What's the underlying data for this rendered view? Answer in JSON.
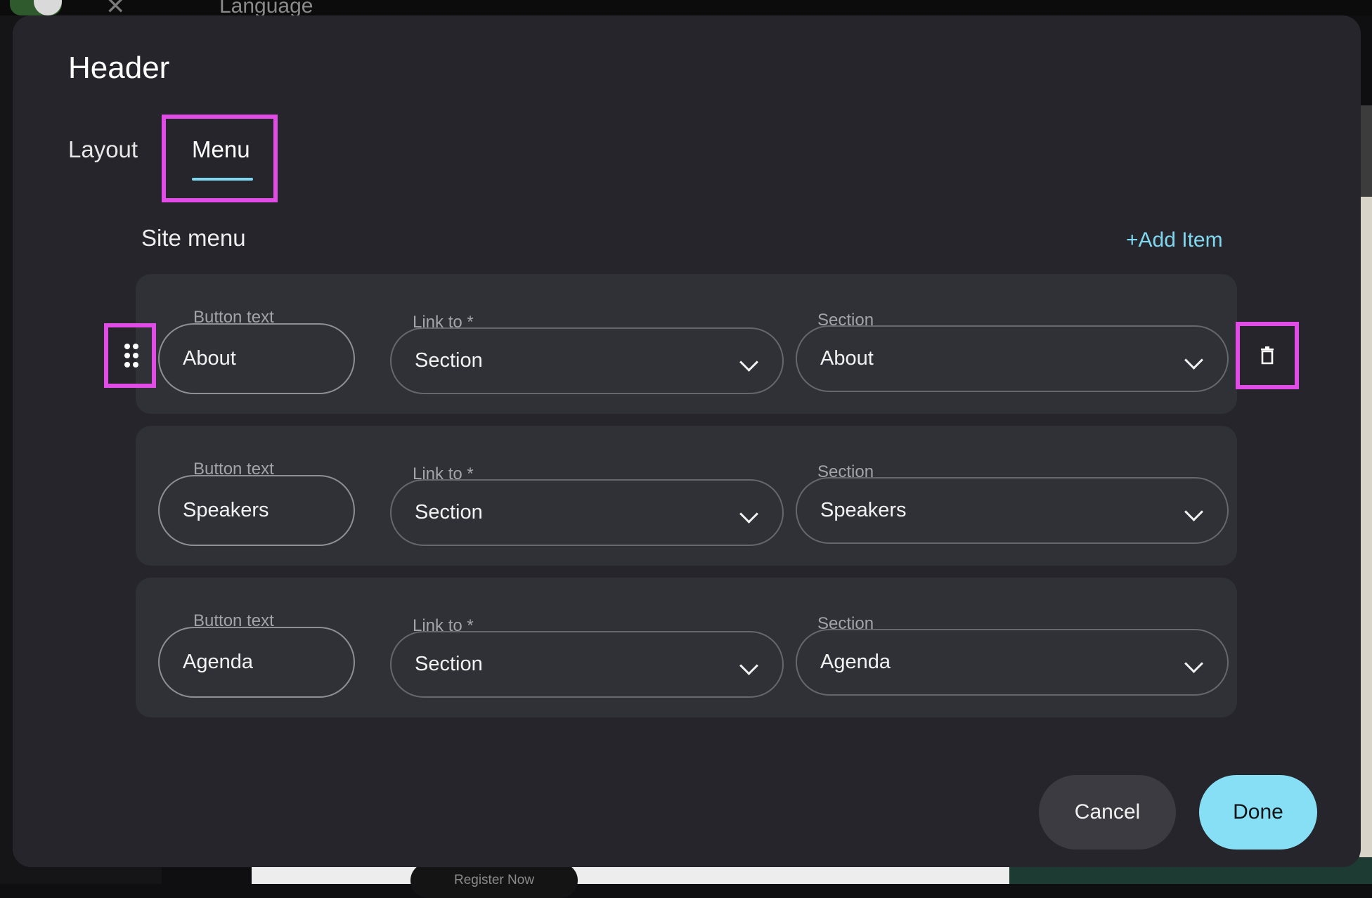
{
  "background": {
    "language_label": "Language",
    "register_label": "Register Now"
  },
  "modal": {
    "title": "Header",
    "tabs": [
      {
        "label": "Layout",
        "active": false
      },
      {
        "label": "Menu",
        "active": true
      }
    ],
    "site_menu": {
      "title": "Site menu",
      "add_item_label": "+Add Item",
      "items": [
        {
          "button_text_label": "Button text",
          "button_text": "About",
          "link_to_label": "Link to *",
          "link_to": "Section",
          "section_label": "Section",
          "section": "About"
        },
        {
          "button_text_label": "Button text",
          "button_text": "Speakers",
          "link_to_label": "Link to *",
          "link_to": "Section",
          "section_label": "Section",
          "section": "Speakers"
        },
        {
          "button_text_label": "Button text",
          "button_text": "Agenda",
          "link_to_label": "Link to *",
          "link_to": "Section",
          "section_label": "Section",
          "section": "Agenda"
        }
      ]
    },
    "actions": {
      "cancel_label": "Cancel",
      "done_label": "Done"
    },
    "colors": {
      "accent": "#7fd8f0",
      "primary_button": "#86dff5",
      "highlight": "#e14ce6",
      "modal_bg": "#26252b",
      "row_bg": "#303037"
    },
    "icons": [
      "drag-handle-icon",
      "trash-icon",
      "chevron-down-icon",
      "close-icon"
    ]
  }
}
